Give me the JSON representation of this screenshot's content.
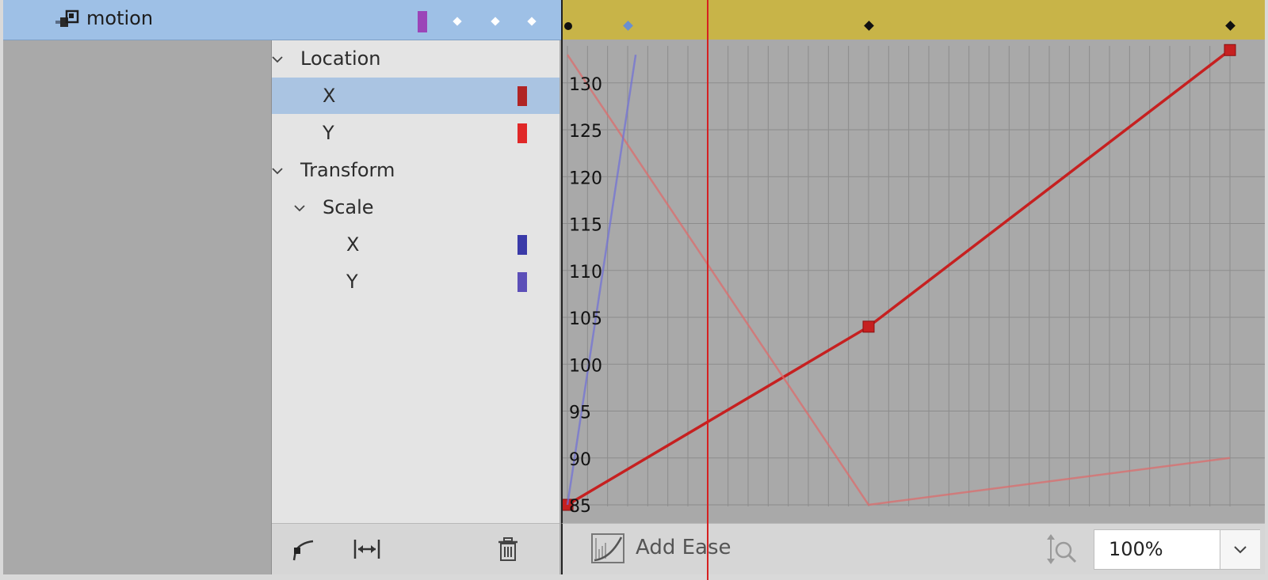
{
  "layer": {
    "name": "motion",
    "icon": "layer-link-icon",
    "color": "#9b45b8"
  },
  "tree": {
    "items": [
      {
        "label": "Location",
        "expanded": true,
        "depth": 0
      },
      {
        "label": "X",
        "depth": 1,
        "selected": true,
        "color": "#b02424"
      },
      {
        "label": "Y",
        "depth": 1,
        "color": "#e02828"
      },
      {
        "label": "Transform",
        "expanded": true,
        "depth": 0
      },
      {
        "label": "Scale",
        "expanded": true,
        "depth": 1
      },
      {
        "label": "X",
        "depth": 2,
        "color": "#3a3aa8"
      },
      {
        "label": "Y",
        "depth": 2,
        "color": "#5c4fb8"
      }
    ],
    "toolbar": {
      "curve_tool": "ease-curve-icon",
      "fit_width": "fit-horizontal-icon",
      "delete": "trash-icon"
    }
  },
  "timeline": {
    "strip_color": "#c8b448",
    "keys": [
      {
        "time": 0,
        "shape": "circle",
        "color": "#111111"
      },
      {
        "time": 3,
        "shape": "diamond",
        "color": "#6a8fd0"
      },
      {
        "time": 15,
        "shape": "diamond",
        "color": "#111111"
      },
      {
        "time": 33,
        "shape": "diamond",
        "color": "#111111"
      }
    ]
  },
  "playhead": {
    "time": 7,
    "color": "#d62020"
  },
  "graph": {
    "y_ticks": [
      130,
      125,
      120,
      115,
      110,
      105,
      100,
      95,
      90,
      85
    ],
    "time_range": [
      0,
      33
    ],
    "value_range": [
      85,
      133.5
    ],
    "curves": [
      {
        "name": "Location X",
        "color": "#c62020",
        "emphasis": "selected",
        "points": [
          [
            0,
            85
          ],
          [
            15,
            104
          ],
          [
            33,
            133.5
          ]
        ],
        "show_keys": true
      },
      {
        "name": "Location Y",
        "color": "#e06a6a",
        "emphasis": "faded",
        "points": [
          [
            0,
            133
          ],
          [
            15,
            85
          ],
          [
            33,
            90
          ]
        ],
        "show_keys": false
      },
      {
        "name": "Scale X",
        "color": "#6f6fd8",
        "emphasis": "faded",
        "points": [
          [
            0,
            85
          ],
          [
            3.4,
            133
          ]
        ],
        "show_keys": false
      }
    ]
  },
  "graph_toolbar": {
    "add_ease_label": "Add Ease",
    "add_ease_icon": "ease-curve-icon",
    "zoom_icon": "vertical-zoom-icon",
    "zoom_value": "100%",
    "zoom_dropdown_icon": "chevron-down-icon"
  }
}
